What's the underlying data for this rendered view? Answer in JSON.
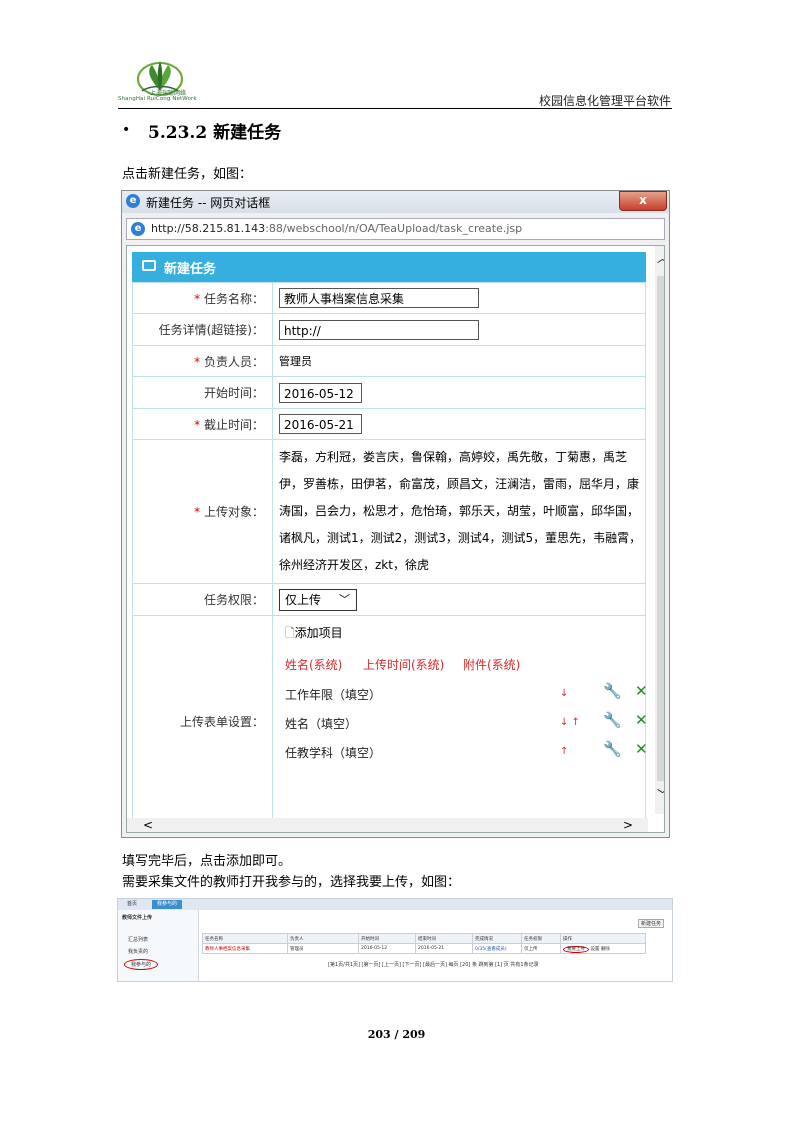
{
  "header": {
    "logo_cn": "上海瑞聪网络",
    "logo_en": "ShangHai RuiCong NetWork",
    "title": "校园信息化管理平台软件"
  },
  "section": {
    "bullet": "•",
    "title": "5.23.2 新建任务"
  },
  "intro_text": "点击新建任务，如图：",
  "dialog": {
    "title": "新建任务 -- 网页对话框",
    "close_symbol": "x",
    "url_host": "http://58.215.81.143",
    "url_path": ":88/webschool/n/OA/TeaUpload/task_create.jsp",
    "form_title": "新建任务",
    "fields": {
      "task_name_label": "任务名称：",
      "task_name_value": "教师人事档案信息采集",
      "task_detail_label": "任务详情(超链接)：",
      "task_detail_value": "http://",
      "owner_label": "负责人员：",
      "owner_value": "管理员",
      "start_label": "开始时间：",
      "start_value": "2016-05-12",
      "end_label": "截止时间：",
      "end_value": "2016-05-21",
      "targets_label": "上传对象：",
      "targets_value": "李磊，方利冠，娄言庆，鲁保翰，高婷姣，禹先敬，丁菊惠，禹芝伊，罗善栋，田伊茗，俞富茂，顾昌文，汪澜洁，雷雨，屈华月，康涛国，吕会力，松思才，危怡琦，郭乐天，胡莹，叶顺富，邱华国，诸枫凡，测试1，测试2，测试3，测试4，测试5，董思先，韦融霄，徐州经济开发区，zkt，徐虎",
      "perm_label": "任务权限：",
      "perm_value": "仅上传",
      "upload_label": "上传表单设置："
    },
    "add_item": "添加项目",
    "system_fields": [
      "姓名(系统)",
      "上传时间(系统)",
      "附件(系统)"
    ],
    "custom_fields": [
      {
        "label": "工作年限（填空）",
        "arrows": "↓"
      },
      {
        "label": "姓名（填空）",
        "arrows": "↓ ↑"
      },
      {
        "label": "任教学科（填空）",
        "arrows": "↑"
      }
    ],
    "icons": {
      "wrench": "wrench-icon",
      "delete": "delete-x-icon"
    }
  },
  "after_text_1": "填写完毕后，点击添加即可。",
  "after_text_2": "需要采集文件的教师打开我参与的，选择我要上传，如图：",
  "screenshot2": {
    "tabs": [
      "首页",
      "我参与的"
    ],
    "side_title": "教师文件上传",
    "side_items": [
      "汇总列表",
      "我负责的",
      "我参与的"
    ],
    "new_task_btn": "新建任务",
    "columns": [
      "任务名称",
      "负责人",
      "开始时间",
      "结束时间",
      "完成情况",
      "任务权限",
      "操作"
    ],
    "row": [
      "教师人事档案信息采集",
      "管理员",
      "2016-05-12",
      "2016-05-21",
      "0/35(查看成员)",
      "仅上传"
    ],
    "row_actions": [
      "我要上传",
      "设置",
      "删除"
    ],
    "pager": "[第1页/共1页] [第一页] [上一页] [下一页] [最后一页] 每页 [20] 条 跳到第 [1] 页 共有1条记录"
  },
  "page_number": "203 / 209"
}
